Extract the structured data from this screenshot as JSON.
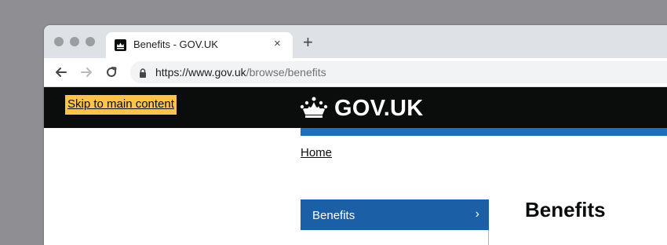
{
  "browser": {
    "tab": {
      "title": "Benefits - GOV.UK",
      "close_glyph": "×"
    },
    "new_tab_glyph": "+",
    "url": {
      "host": "https://www.gov.uk",
      "path": "/browse/benefits"
    }
  },
  "header": {
    "skip_link": "Skip to main content",
    "logo_text": "GOV.UK"
  },
  "breadcrumb": {
    "home": "Home"
  },
  "nav": {
    "selected_label": "Benefits",
    "chevron": "›"
  },
  "main": {
    "title": "Benefits"
  },
  "colors": {
    "header_bg": "#0b0c0c",
    "skip_link_bg": "#fdc34b",
    "brand_blue": "#1d70b8",
    "nav_selected_bg": "#1b5fa7"
  }
}
